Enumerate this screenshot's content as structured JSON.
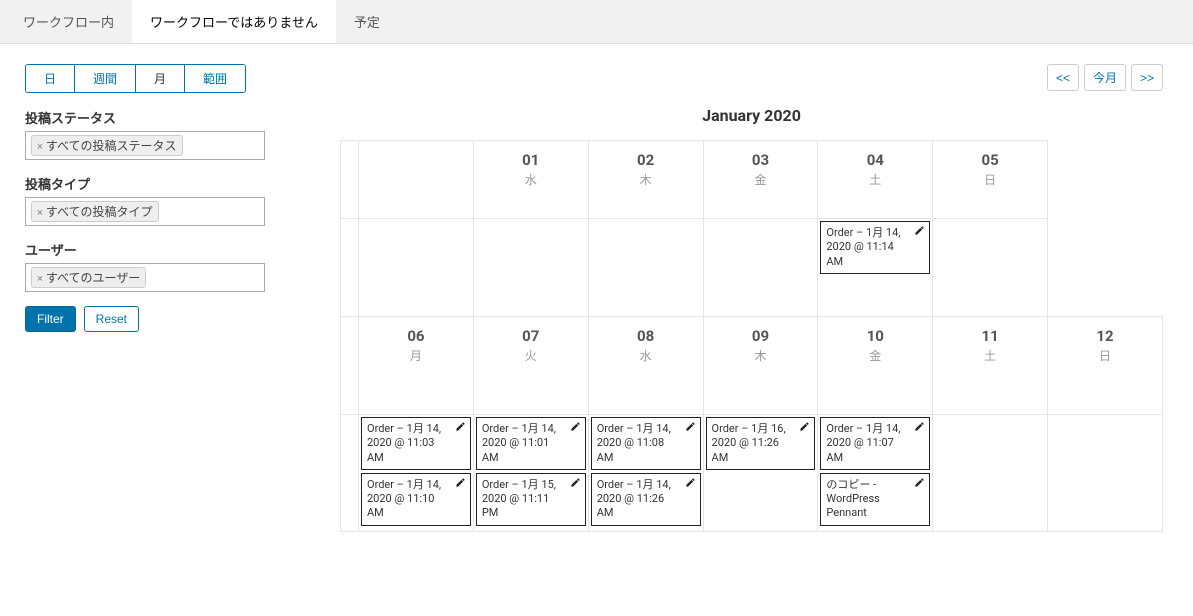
{
  "tabs": {
    "in_workflow": "ワークフロー内",
    "not_workflow": "ワークフローではありません",
    "scheduled": "予定"
  },
  "sidebar": {
    "view": {
      "day": "日",
      "week": "週間",
      "month": "月",
      "range": "範囲"
    },
    "status_label": "投稿ステータス",
    "status_tag": "すべての投稿ステータス",
    "type_label": "投稿タイプ",
    "type_tag": "すべての投稿タイプ",
    "user_label": "ユーザー",
    "user_tag": "すべてのユーザー",
    "filter_btn": "Filter",
    "reset_btn": "Reset"
  },
  "calendar": {
    "title": "January 2020",
    "nav_prev": "<<",
    "nav_today": "今月",
    "nav_next": ">>",
    "week1": [
      {
        "num": "01",
        "wk": "水",
        "events": []
      },
      {
        "num": "02",
        "wk": "木",
        "events": []
      },
      {
        "num": "03",
        "wk": "金",
        "events": []
      },
      {
        "num": "04",
        "wk": "土",
        "events": [
          "Order – 1月 14, 2020 @ 11:14 AM"
        ]
      },
      {
        "num": "05",
        "wk": "日",
        "events": []
      }
    ],
    "week2": [
      {
        "num": "06",
        "wk": "月",
        "events": [
          "Order – 1月 14, 2020 @ 11:03 AM",
          "Order – 1月 14, 2020 @ 11:10 AM"
        ]
      },
      {
        "num": "07",
        "wk": "火",
        "events": [
          "Order – 1月 14, 2020 @ 11:01 AM",
          "Order – 1月 15, 2020 @ 11:11 PM"
        ]
      },
      {
        "num": "08",
        "wk": "水",
        "events": [
          "Order – 1月 14, 2020 @ 11:08 AM",
          "Order – 1月 14, 2020 @ 11:26 AM"
        ]
      },
      {
        "num": "09",
        "wk": "木",
        "events": [
          "Order – 1月 16, 2020 @ 11:26 AM"
        ]
      },
      {
        "num": "10",
        "wk": "金",
        "events": [
          "Order – 1月 14, 2020 @ 11:07 AM",
          "のコピー - WordPress Pennant"
        ]
      },
      {
        "num": "11",
        "wk": "土",
        "events": []
      },
      {
        "num": "12",
        "wk": "日",
        "events": []
      }
    ]
  }
}
